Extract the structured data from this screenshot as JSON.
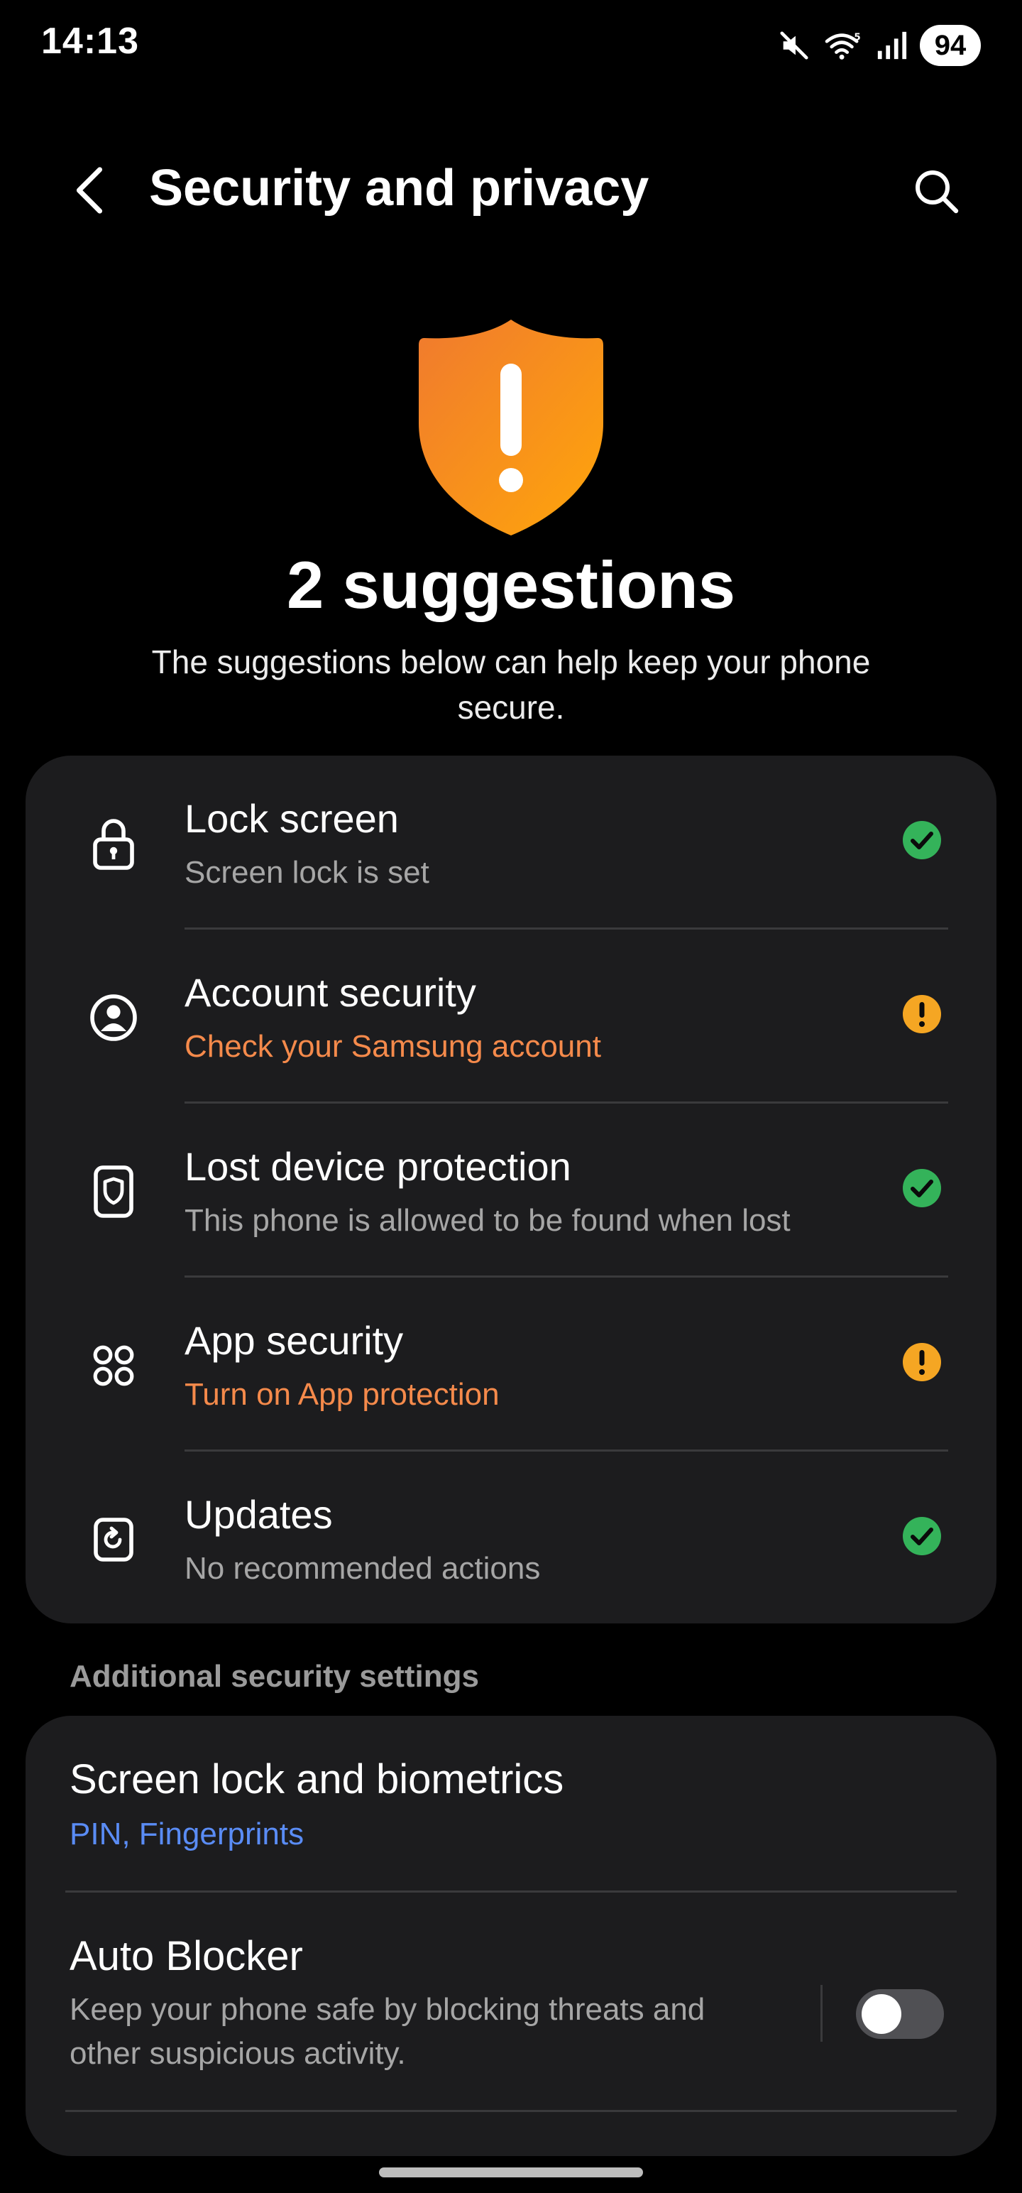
{
  "status_bar": {
    "time": "14:13",
    "battery": "94",
    "icons": [
      "mute-icon",
      "wifi-icon",
      "signal-icon"
    ]
  },
  "header": {
    "title": "Security and privacy",
    "back_icon": "chevron-left-icon",
    "search_icon": "search-icon"
  },
  "hero": {
    "icon": "warning-shield-icon",
    "title": "2 suggestions",
    "subtitle": "The suggestions below can help keep your phone secure."
  },
  "suggestions": [
    {
      "title": "Lock screen",
      "subtitle": "Screen lock is set",
      "status": "ok",
      "icon": "lock-icon"
    },
    {
      "title": "Account security",
      "subtitle": "Check your Samsung account",
      "status": "warning",
      "icon": "account-icon"
    },
    {
      "title": "Lost device protection",
      "subtitle": "This phone is allowed to be found when lost",
      "status": "ok",
      "icon": "device-shield-icon"
    },
    {
      "title": "App security",
      "subtitle": "Turn on App protection",
      "status": "warning",
      "icon": "apps-grid-icon"
    },
    {
      "title": "Updates",
      "subtitle": "No recommended actions",
      "status": "ok",
      "icon": "update-icon"
    }
  ],
  "additional": {
    "header": "Additional security settings",
    "items": [
      {
        "title": "Screen lock and biometrics",
        "subtitle": "PIN, Fingerprints"
      },
      {
        "title": "Auto Blocker",
        "subtitle": "Keep your phone safe by blocking threats and other suspicious activity.",
        "toggle_on": false
      }
    ]
  },
  "colors": {
    "background": "#000000",
    "card": "#1c1c1e",
    "ok": "#34b35a",
    "warning": "#f5a623",
    "warning_text": "#f58a4b",
    "link_blue": "#5a8cf5"
  }
}
